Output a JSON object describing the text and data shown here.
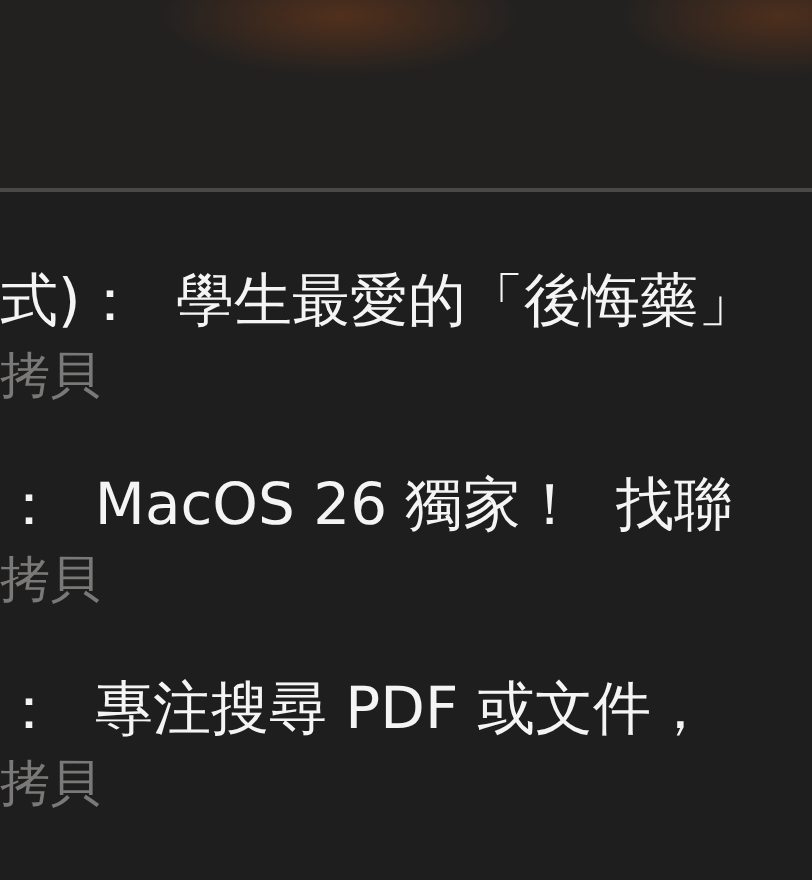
{
  "items": [
    {
      "title": "式)：  學生最愛的「後悔藥」",
      "subtitle": "拷貝"
    },
    {
      "title": "：  MacOS 26 獨家！  找聯",
      "subtitle": "拷貝"
    },
    {
      "title": "：  專注搜尋 PDF 或文件，",
      "subtitle": "拷貝"
    }
  ]
}
